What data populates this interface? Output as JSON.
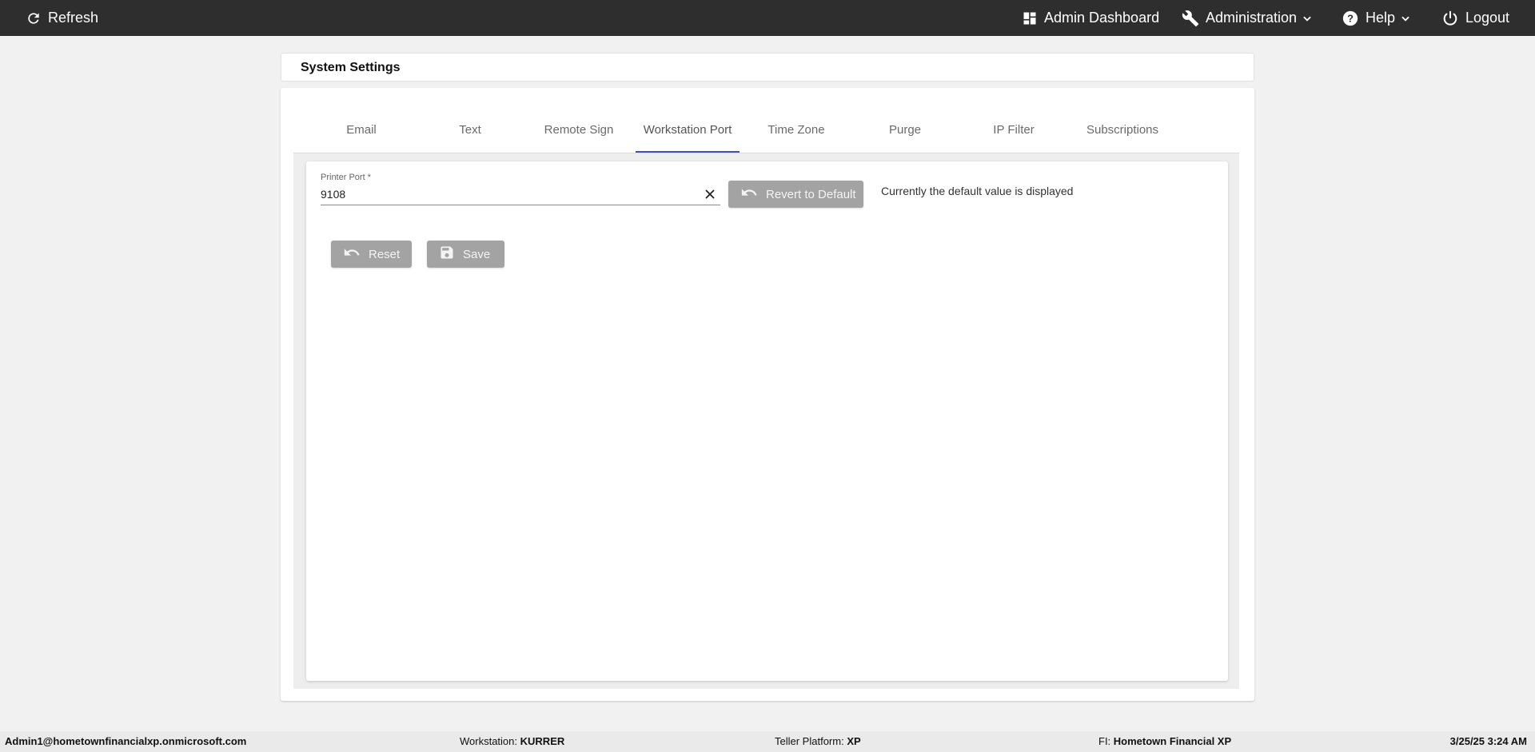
{
  "topbar": {
    "refresh_label": "Refresh",
    "admin_dashboard_label": "Admin Dashboard",
    "administration_label": "Administration",
    "help_label": "Help",
    "logout_label": "Logout",
    "background_color": "#2e2e2e"
  },
  "page": {
    "title": "System Settings"
  },
  "tabs": [
    {
      "label": "Email"
    },
    {
      "label": "Text"
    },
    {
      "label": "Remote Sign"
    },
    {
      "label": "Workstation Port",
      "active": true
    },
    {
      "label": "Time Zone"
    },
    {
      "label": "Purge"
    },
    {
      "label": "IP Filter"
    },
    {
      "label": "Subscriptions"
    }
  ],
  "form": {
    "printer_port_label": "Printer Port *",
    "printer_port_value": "9108",
    "revert_label": "Revert to Default",
    "default_note": "Currently the default value is displayed",
    "reset_label": "Reset",
    "save_label": "Save"
  },
  "footer": {
    "user": "Admin1@hometownfinancialxp.onmicrosoft.com",
    "workstation_label": "Workstation:",
    "workstation_value": "KURRER",
    "platform_label": "Teller Platform:",
    "platform_value": "XP",
    "fi_label": "FI:",
    "fi_value": "Hometown Financial XP",
    "datetime": "3/25/25 3:24 AM"
  },
  "colors": {
    "accent": "#3f51b5",
    "button_disabled": "#a3a3a3"
  }
}
